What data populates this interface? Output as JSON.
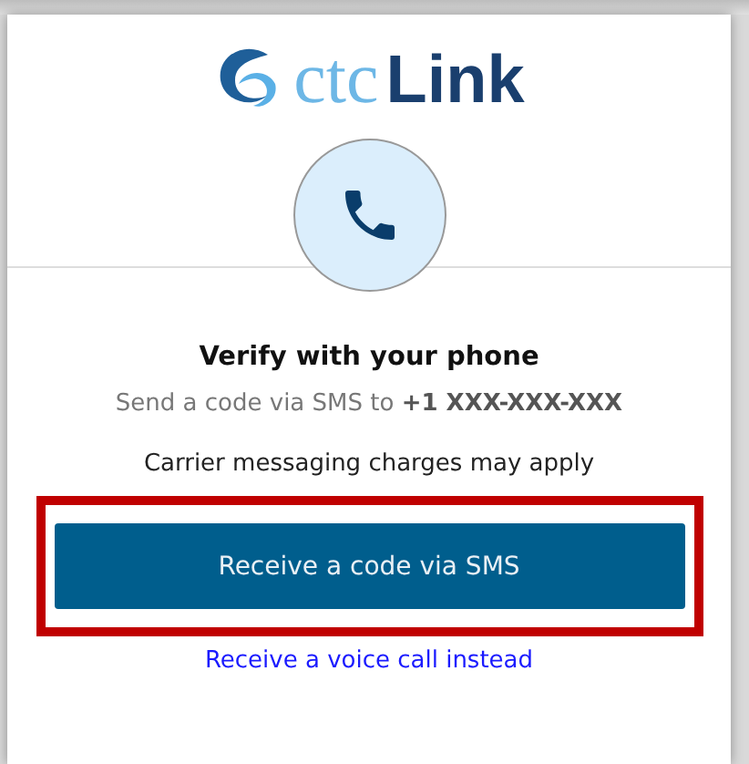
{
  "logo": {
    "prefix": "ctc",
    "name": "Link"
  },
  "heading": "Verify with your phone",
  "subtitle": "Send a code via SMS to **+1 XXX-XXX-XXX**",
  "notice": "Carrier messaging charges may apply",
  "primary_button": {
    "label": "Receive a code via SMS",
    "highlighted": true
  },
  "alternate_link": "Receive a voice call instead"
}
